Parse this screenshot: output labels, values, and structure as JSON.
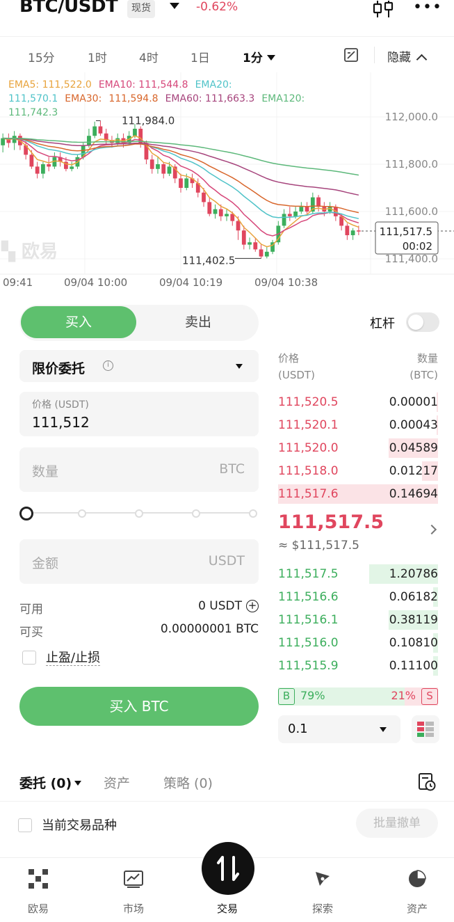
{
  "header": {
    "pair": "BTC/USDT",
    "market_type": "现货",
    "change": "-0.62%"
  },
  "intervals": {
    "items": [
      "15分",
      "1时",
      "4时",
      "1日"
    ],
    "active": "1分",
    "hide_label": "隐藏"
  },
  "chart_data": {
    "type": "candlestick",
    "indicators": [
      {
        "name": "EMA5",
        "label": "EMA5: 111,522.0",
        "color": "#e8a33c"
      },
      {
        "name": "EMA10",
        "label": "EMA10: 111,544.8",
        "color": "#d6477a"
      },
      {
        "name": "EMA20",
        "label": "EMA20: 111,570.1",
        "color": "#4fc3c8"
      },
      {
        "name": "EMA30",
        "label": "EMA30:",
        "color": "#d8662b"
      },
      {
        "name": "EMA30_value",
        "label": "111,594.8",
        "color": "#d8662b"
      },
      {
        "name": "EMA60",
        "label": "EMA60: 111,663.3",
        "color": "#a6447c"
      },
      {
        "name": "EMA120",
        "label": "EMA120: 111,742.3",
        "color": "#5cb87a"
      }
    ],
    "y_ticks": [
      "112,000.0",
      "111,800.0",
      "111,600.0",
      "111,400.0"
    ],
    "x_ticks": [
      "09:41",
      "09/04 10:00",
      "09/04 10:19",
      "09/04 10:38"
    ],
    "high_marker": "111,984.0",
    "low_marker": "111,402.5",
    "current_price": "111,517.5",
    "countdown": "00:02",
    "watermark": "欧易",
    "ylim": [
      111350,
      112100
    ],
    "candles": [
      [
        111880,
        111910,
        111850,
        111930
      ],
      [
        111910,
        111890,
        111870,
        111930
      ],
      [
        111890,
        111920,
        111860,
        111940
      ],
      [
        111920,
        111880,
        111860,
        111930
      ],
      [
        111880,
        111840,
        111820,
        111900
      ],
      [
        111840,
        111790,
        111780,
        111860
      ],
      [
        111790,
        111760,
        111740,
        111810
      ],
      [
        111760,
        111800,
        111740,
        111810
      ],
      [
        111800,
        111790,
        111770,
        111830
      ],
      [
        111790,
        111830,
        111780,
        111850
      ],
      [
        111830,
        111810,
        111790,
        111850
      ],
      [
        111810,
        111780,
        111770,
        111830
      ],
      [
        111780,
        111790,
        111770,
        111810
      ],
      [
        111790,
        111830,
        111780,
        111840
      ],
      [
        111830,
        111880,
        111820,
        111890
      ],
      [
        111880,
        111920,
        111870,
        111950
      ],
      [
        111920,
        111960,
        111910,
        111980
      ],
      [
        111960,
        111930,
        111920,
        111984
      ],
      [
        111930,
        111900,
        111880,
        111950
      ],
      [
        111900,
        111890,
        111870,
        111920
      ],
      [
        111890,
        111910,
        111880,
        111930
      ],
      [
        111910,
        111890,
        111870,
        111930
      ],
      [
        111890,
        111920,
        111880,
        111940
      ],
      [
        111920,
        111950,
        111910,
        111970
      ],
      [
        111950,
        111890,
        111870,
        111960
      ],
      [
        111890,
        111820,
        111800,
        111900
      ],
      [
        111820,
        111780,
        111760,
        111840
      ],
      [
        111780,
        111800,
        111760,
        111830
      ],
      [
        111800,
        111760,
        111740,
        111810
      ],
      [
        111760,
        111790,
        111750,
        111810
      ],
      [
        111790,
        111740,
        111720,
        111800
      ],
      [
        111740,
        111700,
        111680,
        111760
      ],
      [
        111700,
        111740,
        111690,
        111760
      ],
      [
        111740,
        111720,
        111700,
        111760
      ],
      [
        111720,
        111680,
        111660,
        111740
      ],
      [
        111680,
        111640,
        111620,
        111700
      ],
      [
        111640,
        111590,
        111580,
        111660
      ],
      [
        111590,
        111610,
        111570,
        111630
      ],
      [
        111610,
        111580,
        111560,
        111630
      ],
      [
        111580,
        111590,
        111560,
        111610
      ],
      [
        111590,
        111560,
        111540,
        111600
      ],
      [
        111560,
        111520,
        111480,
        111580
      ],
      [
        111520,
        111460,
        111440,
        111540
      ],
      [
        111460,
        111470,
        111440,
        111490
      ],
      [
        111470,
        111440,
        111430,
        111490
      ],
      [
        111440,
        111410,
        111402,
        111460
      ],
      [
        111410,
        111430,
        111402,
        111450
      ],
      [
        111430,
        111470,
        111420,
        111480
      ],
      [
        111470,
        111540,
        111460,
        111560
      ],
      [
        111540,
        111590,
        111530,
        111610
      ],
      [
        111590,
        111580,
        111560,
        111620
      ],
      [
        111580,
        111600,
        111570,
        111620
      ],
      [
        111600,
        111620,
        111590,
        111640
      ],
      [
        111620,
        111600,
        111590,
        111640
      ],
      [
        111600,
        111660,
        111590,
        111680
      ],
      [
        111660,
        111620,
        111600,
        111670
      ],
      [
        111620,
        111600,
        111580,
        111640
      ],
      [
        111600,
        111620,
        111590,
        111640
      ],
      [
        111620,
        111580,
        111560,
        111630
      ],
      [
        111580,
        111540,
        111520,
        111590
      ],
      [
        111540,
        111500,
        111480,
        111550
      ],
      [
        111500,
        111520,
        111480,
        111530
      ],
      [
        111520,
        111517,
        111500,
        111540
      ]
    ]
  },
  "form": {
    "buy_label": "买入",
    "sell_label": "卖出",
    "leverage_label": "杠杆",
    "order_type": "限价委托",
    "info_glyph": "i",
    "price_label": "价格 (USDT)",
    "price_value": "111,512",
    "qty_placeholder": "数量",
    "qty_unit": "BTC",
    "amount_placeholder": "金额",
    "amount_unit": "USDT",
    "available_label": "可用",
    "available_value": "0 USDT",
    "buyable_label": "可买",
    "buyable_value": "0.00000001 BTC",
    "tpsl_label": "止盈/止损",
    "buy_button": "买入 BTC"
  },
  "orderbook": {
    "price_header": "价格",
    "price_unit": "(USDT)",
    "qty_header": "数量",
    "qty_unit": "(BTC)",
    "asks": [
      {
        "price": "111,520.5",
        "qty": "0.00001",
        "depth": 0.01
      },
      {
        "price": "111,520.1",
        "qty": "0.00043",
        "depth": 0.01
      },
      {
        "price": "111,520.0",
        "qty": "0.04589",
        "depth": 0.31
      },
      {
        "price": "111,518.0",
        "qty": "0.01217",
        "depth": 0.1
      },
      {
        "price": "111,517.6",
        "qty": "0.14694",
        "depth": 1.0
      }
    ],
    "mid_price": "111,517.5",
    "mid_usd": "≈ $111,517.5",
    "bids": [
      {
        "price": "111,517.5",
        "qty": "1.20786",
        "depth": 0.43
      },
      {
        "price": "111,516.6",
        "qty": "0.06182",
        "depth": 0.03
      },
      {
        "price": "111,516.1",
        "qty": "0.38119",
        "depth": 0.31
      },
      {
        "price": "111,516.0",
        "qty": "0.10810",
        "depth": 0.03
      },
      {
        "price": "111,515.9",
        "qty": "0.11100",
        "depth": 0.03
      }
    ],
    "buy_letter": "B",
    "sell_letter": "S",
    "buy_ratio": "79%",
    "sell_ratio": "21%",
    "buy_ratio_value": 0.79,
    "depth_step": "0.1"
  },
  "orders": {
    "tab_orders": "委托 (0)",
    "tab_assets": "资产",
    "tab_strategy": "策略 (0)",
    "current_pair_label": "当前交易品种",
    "batch_cancel": "批量撤单"
  },
  "nav": {
    "items": [
      "欧易",
      "市场",
      "交易",
      "探索",
      "资产"
    ],
    "active": "交易"
  }
}
